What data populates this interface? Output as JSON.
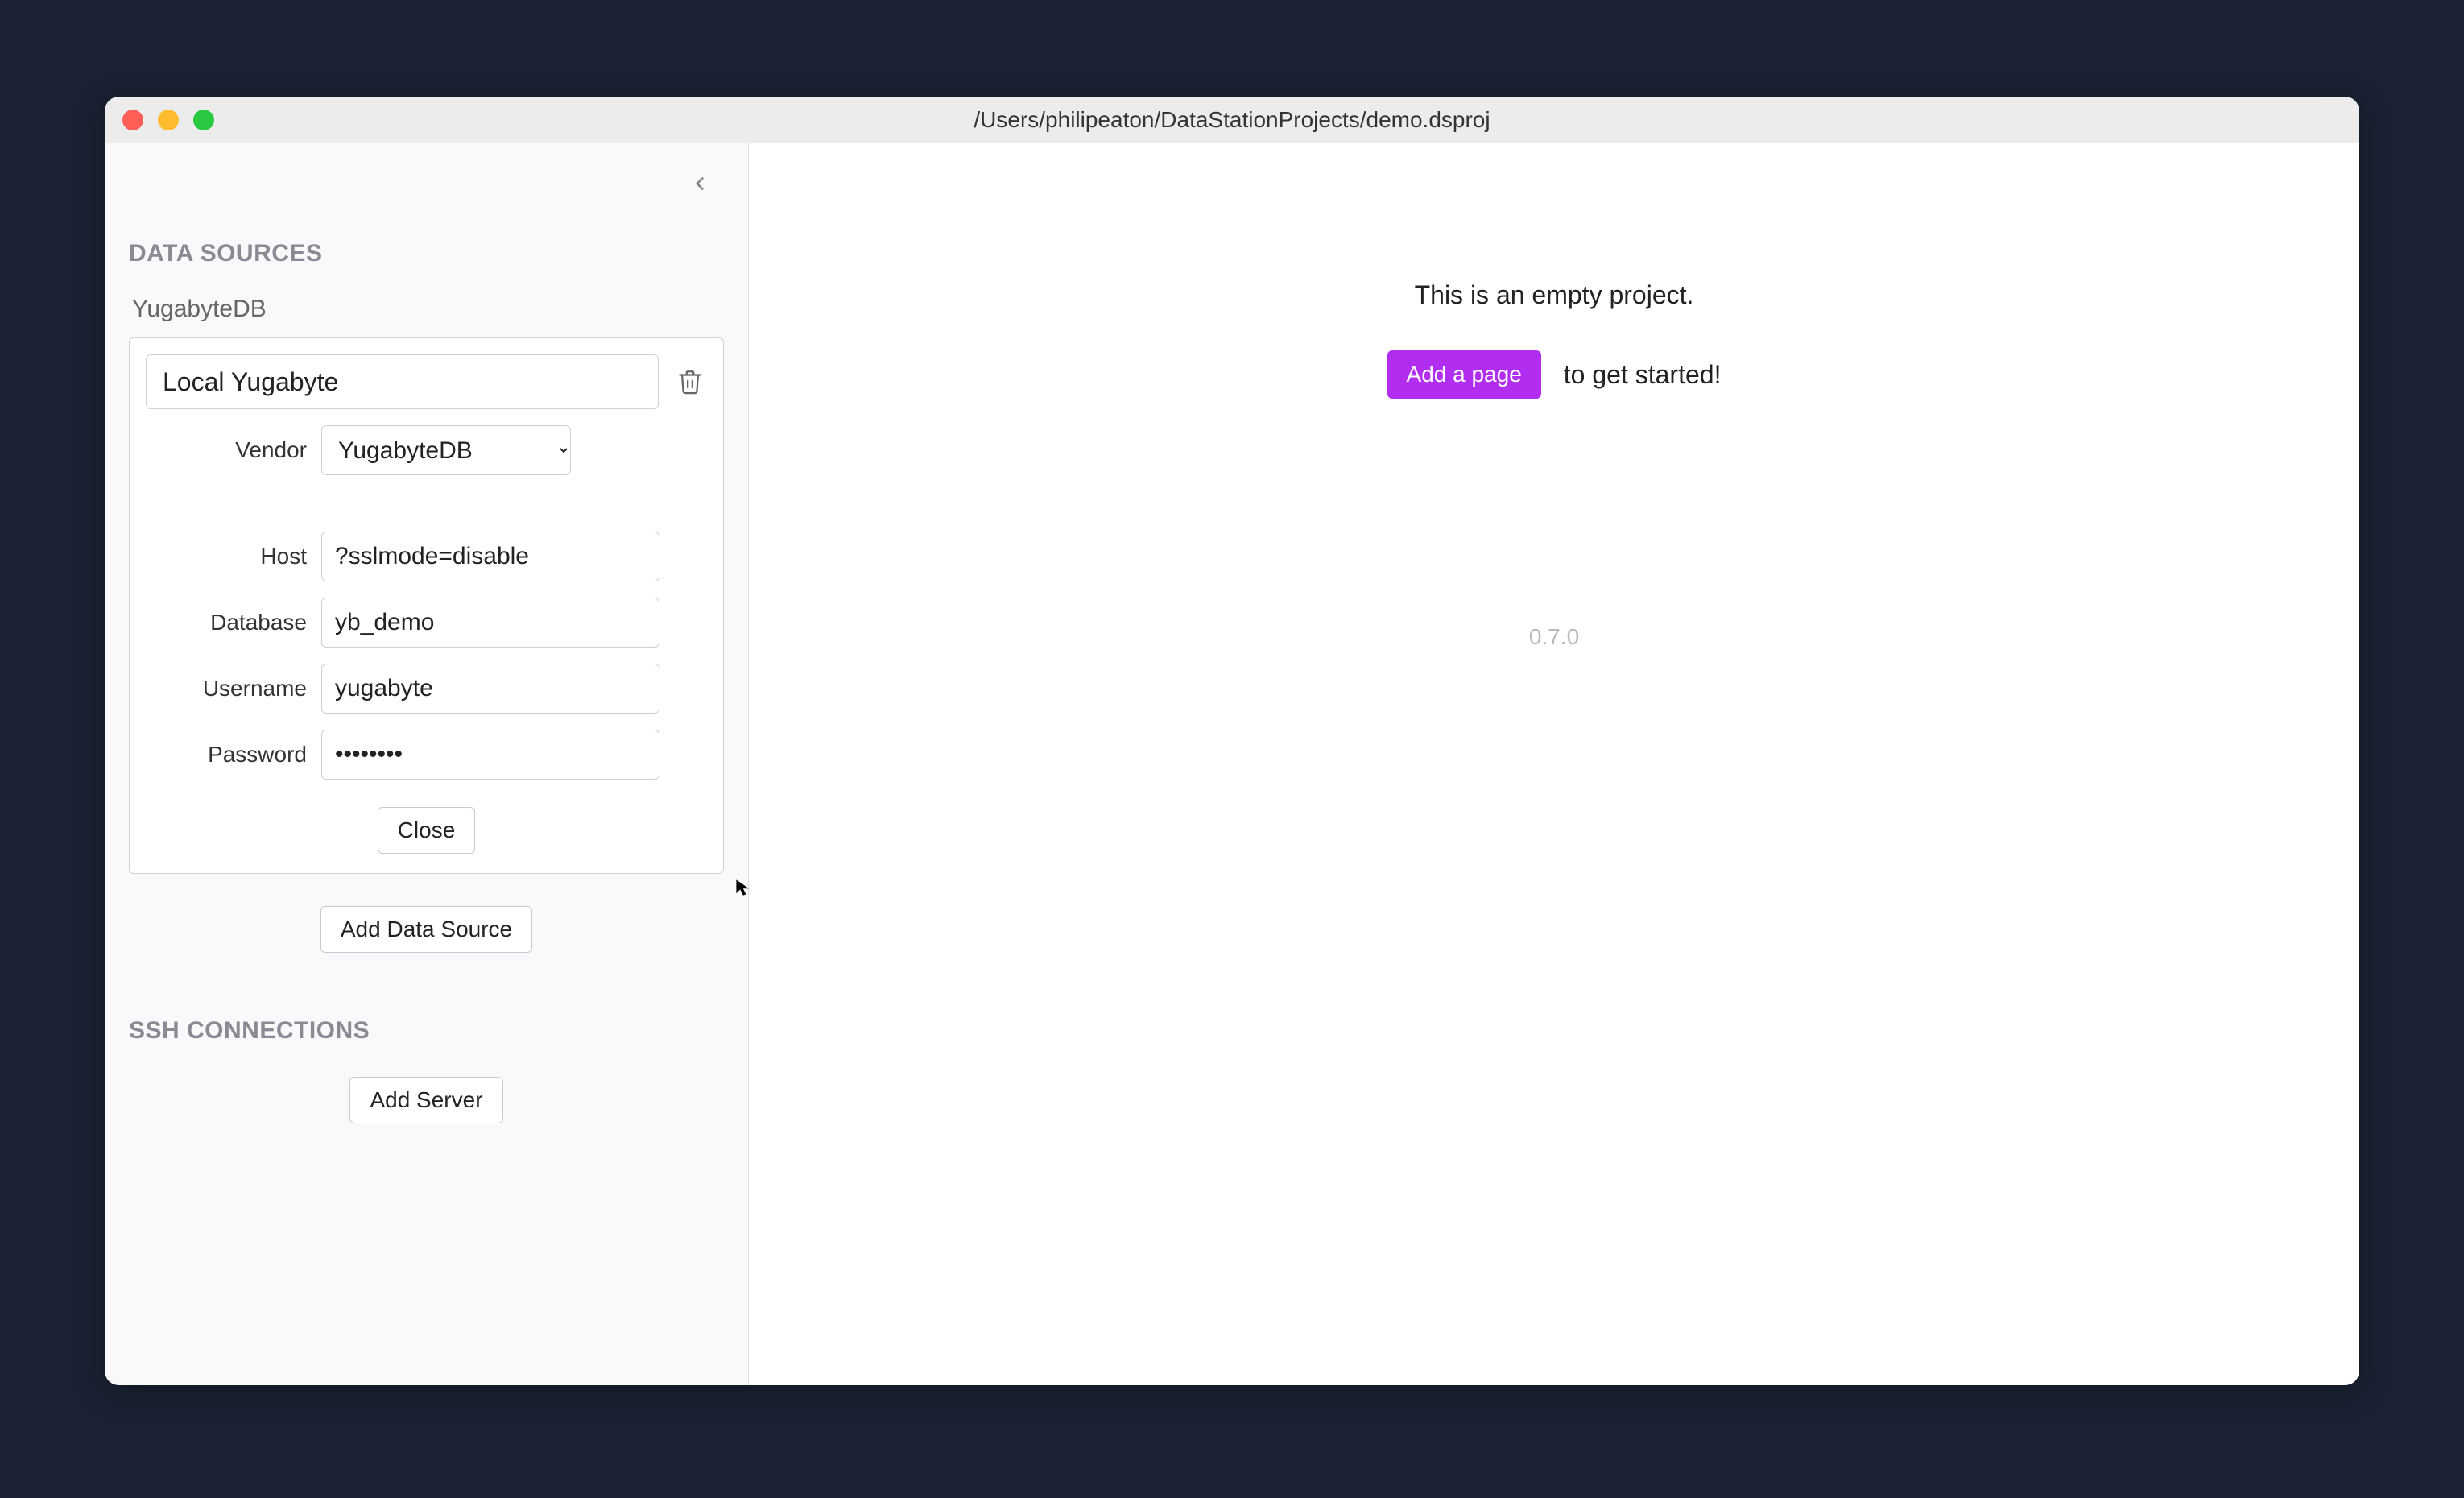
{
  "titlebar": {
    "title": "/Users/philipeaton/DataStationProjects/demo.dsproj"
  },
  "sidebar": {
    "data_sources_header": "DATA SOURCES",
    "ssh_header": "SSH CONNECTIONS",
    "category_label": "YugabyteDB",
    "source": {
      "name": "Local Yugabyte",
      "vendor_label": "Vendor",
      "vendor_value": "YugabyteDB",
      "host_label": "Host",
      "host_value": "?sslmode=disable",
      "database_label": "Database",
      "database_value": "yb_demo",
      "username_label": "Username",
      "username_value": "yugabyte",
      "password_label": "Password",
      "password_value": "••••••••",
      "close_label": "Close"
    },
    "add_ds_label": "Add Data Source",
    "add_server_label": "Add Server"
  },
  "main": {
    "empty_message": "This is an empty project.",
    "add_page_label": "Add a page",
    "get_started_suffix": "to get started!",
    "version": "0.7.0"
  }
}
